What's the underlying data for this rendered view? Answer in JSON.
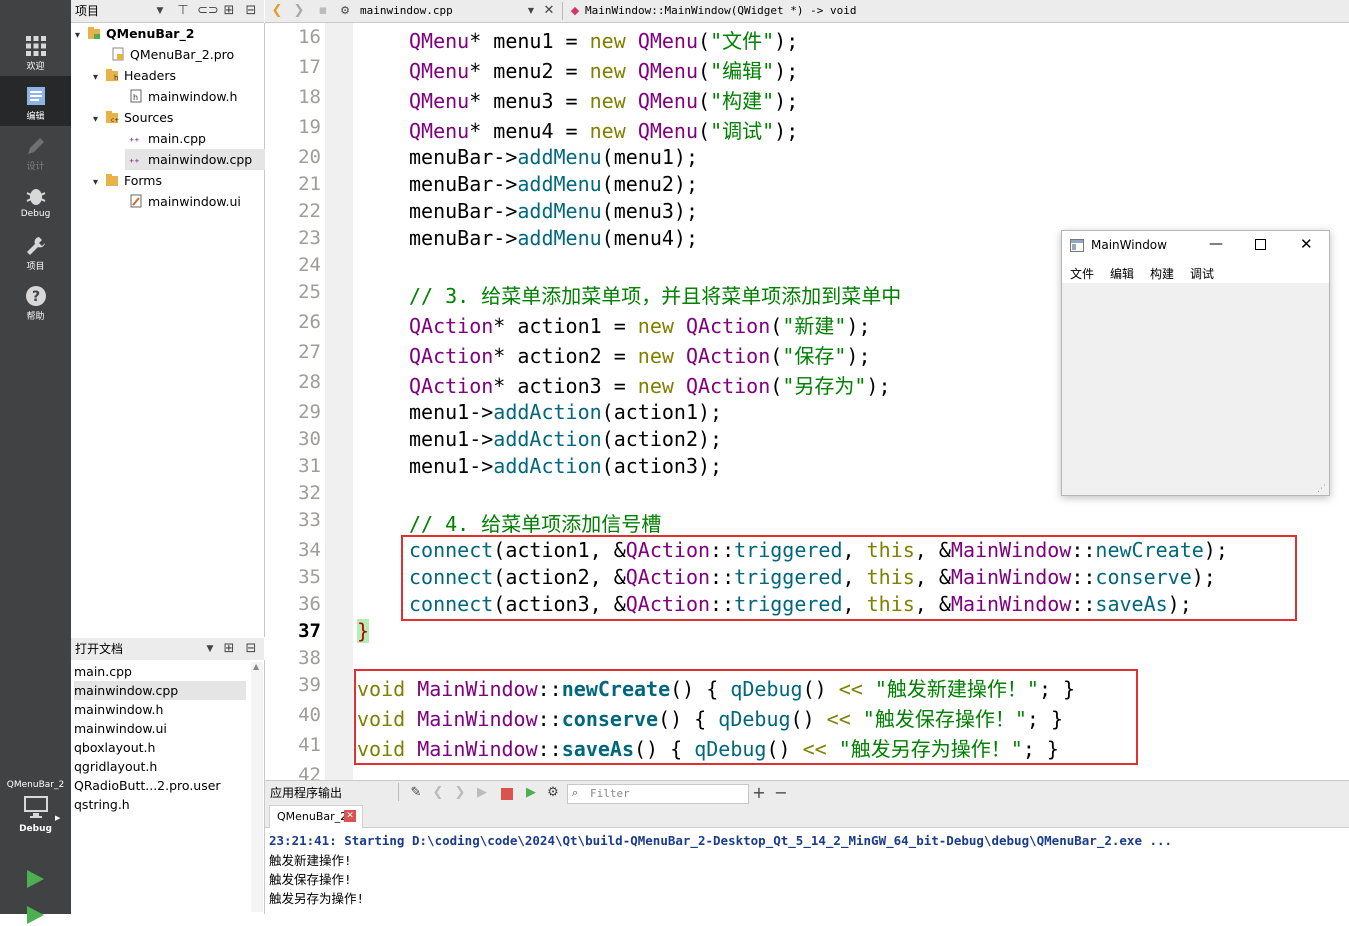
{
  "modebar": {
    "items": [
      {
        "label": "欢迎",
        "icon": "grid-icon"
      },
      {
        "label": "编辑",
        "icon": "edit-icon"
      },
      {
        "label": "设计",
        "icon": "pencil-icon"
      },
      {
        "label": "Debug",
        "icon": "bug-icon"
      },
      {
        "label": "项目",
        "icon": "wrench-icon"
      },
      {
        "label": "帮助",
        "icon": "help-icon"
      }
    ],
    "kit_label": "QMenuBar_2",
    "kit_mode": "Debug"
  },
  "project_panel": {
    "title": "项目",
    "tree": [
      {
        "label": "QMenuBar_2",
        "level": 0,
        "expanded": true,
        "icon": "project-icon"
      },
      {
        "label": "QMenuBar_2.pro",
        "level": 1,
        "icon": "pro-file-icon"
      },
      {
        "label": "Headers",
        "level": 1,
        "expanded": true,
        "icon": "folder-h-icon"
      },
      {
        "label": "mainwindow.h",
        "level": 2,
        "icon": "header-file-icon"
      },
      {
        "label": "Sources",
        "level": 1,
        "expanded": true,
        "icon": "folder-cpp-icon"
      },
      {
        "label": "main.cpp",
        "level": 2,
        "icon": "cpp-file-icon"
      },
      {
        "label": "mainwindow.cpp",
        "level": 2,
        "icon": "cpp-file-icon",
        "selected": true
      },
      {
        "label": "Forms",
        "level": 1,
        "expanded": true,
        "icon": "folder-icon"
      },
      {
        "label": "mainwindow.ui",
        "level": 2,
        "icon": "ui-file-icon"
      }
    ]
  },
  "open_docs": {
    "title": "打开文档",
    "items": [
      "main.cpp",
      "mainwindow.cpp",
      "mainwindow.h",
      "mainwindow.ui",
      "qboxlayout.h",
      "qgridlayout.h",
      "QRadioButt...2.pro.user",
      "qstring.h"
    ],
    "selected": "mainwindow.cpp"
  },
  "editor_toolbar": {
    "file": "mainwindow.cpp",
    "symbol": "MainWindow::MainWindow(QWidget *) -> void"
  },
  "editor": {
    "current_line": "37",
    "line_numbers": [
      "16",
      "17",
      "18",
      "19",
      "20",
      "21",
      "22",
      "23",
      "24",
      "25",
      "26",
      "27",
      "28",
      "29",
      "30",
      "31",
      "32",
      "33",
      "34",
      "35",
      "36",
      "37",
      "38",
      "39",
      "40",
      "41",
      "42"
    ]
  },
  "floating_window": {
    "title": "MainWindow",
    "menus": [
      "文件",
      "编辑",
      "构建",
      "调试"
    ]
  },
  "output": {
    "title": "应用程序输出",
    "filter_placeholder": "Filter",
    "tab": "QMenuBar_2",
    "lines": [
      "23:21:41: Starting D:\\coding\\code\\2024\\Qt\\build-QMenuBar_2-Desktop_Qt_5_14_2_MinGW_64_bit-Debug\\debug\\QMenuBar_2.exe ...",
      "触发新建操作!",
      "触发保存操作!",
      "触发另存为操作!"
    ]
  },
  "colors": {
    "accent_red": "#e03030",
    "mode_bar": "#404244",
    "run_green": "#4caf50"
  }
}
